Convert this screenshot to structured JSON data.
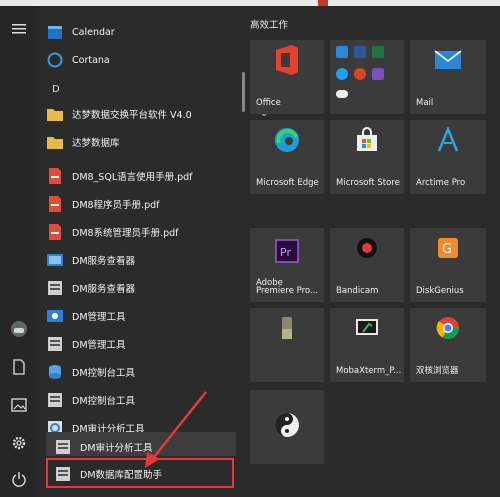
{
  "apps": {
    "calendar": "Calendar",
    "cortana": "Cortana",
    "letter_d": "D",
    "folder1": "达梦数据交换平台软件 V4.0",
    "folder2": "达梦数据库",
    "item1": "DM8_SQL语言使用手册.pdf",
    "item2": "DM8程序员手册.pdf",
    "item3": "DM8系统管理员手册.pdf",
    "item4": "DM服务查看器",
    "item5": "DM服务查看器",
    "item6": "DM管理工具",
    "item7": "DM管理工具",
    "item8": "DM控制台工具",
    "item9": "DM控制台工具",
    "item10": "DM审计分析工具",
    "item11": "DM审计分析工具",
    "item12": "DM数据库配置助手"
  },
  "tiles": {
    "group_title": "高效工作",
    "office": "Office",
    "mail": "Mail",
    "edge": "Microsoft Edge",
    "store": "Microsoft Store",
    "arctime": "Arctime Pro",
    "premiere_line1": "Adobe",
    "premiere_line2": "Premiere Pro...",
    "bandicam": "Bandicam",
    "diskgenius": "DiskGenius",
    "mobaxterm": "MobaXterm_P...",
    "browser": "双核浏览器"
  },
  "colors": {
    "highlight_box": "#e53935",
    "tile_bg": "#3b3b3b",
    "background": "#2b2b2b"
  }
}
